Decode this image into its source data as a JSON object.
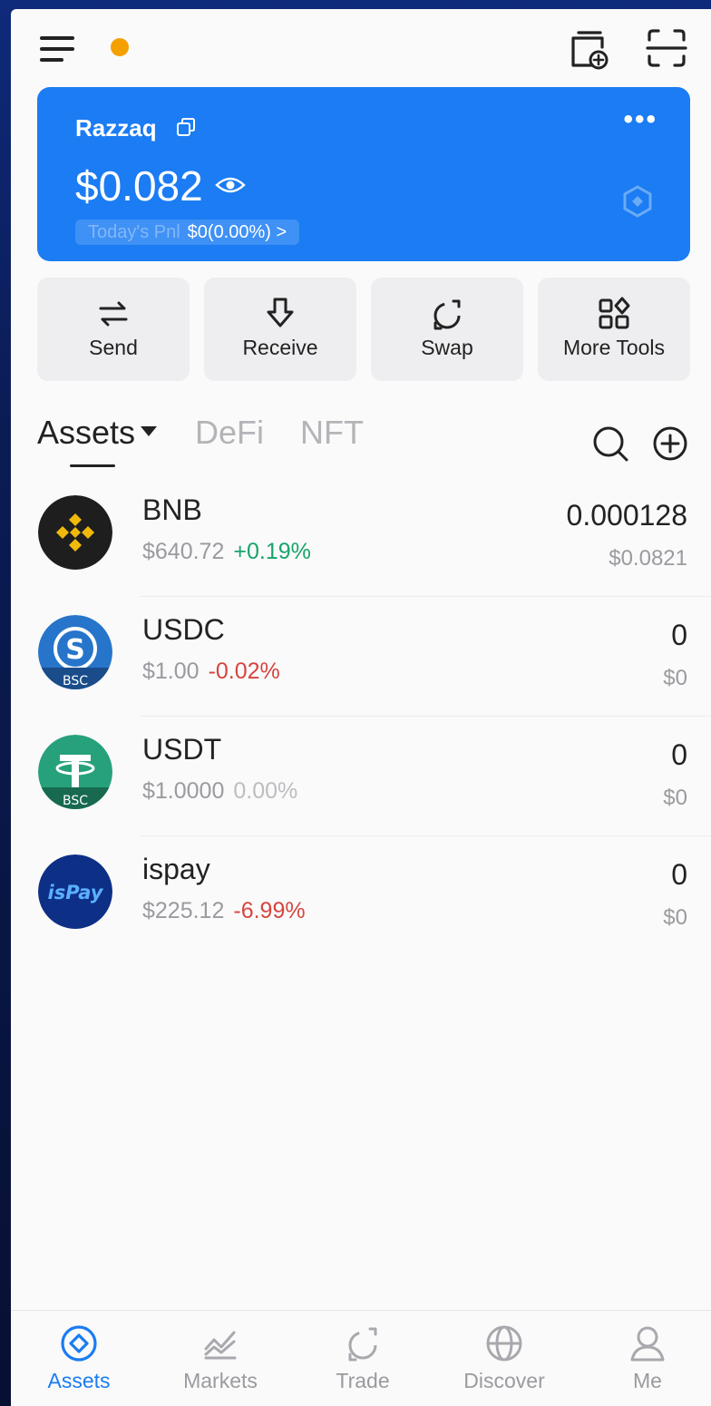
{
  "account": {
    "name": "Razzaq",
    "balance": "$0.082",
    "pnl_label": "Today's Pnl",
    "pnl_value": "$0(0.00%) >"
  },
  "actions": [
    {
      "label": "Send",
      "icon": "send-icon"
    },
    {
      "label": "Receive",
      "icon": "receive-icon"
    },
    {
      "label": "Swap",
      "icon": "swap-icon"
    },
    {
      "label": "More Tools",
      "icon": "grid-icon"
    }
  ],
  "tabs": [
    {
      "label": "Assets",
      "active": true
    },
    {
      "label": "DeFi",
      "active": false
    },
    {
      "label": "NFT",
      "active": false
    }
  ],
  "assets": [
    {
      "symbol": "BNB",
      "price": "$640.72",
      "change": "+0.19%",
      "trend": "up",
      "amount": "0.000128",
      "value": "$0.0821"
    },
    {
      "symbol": "USDC",
      "price": "$1.00",
      "change": "-0.02%",
      "trend": "down",
      "amount": "0",
      "value": "$0",
      "badge": "BSC"
    },
    {
      "symbol": "USDT",
      "price": "$1.0000",
      "change": "0.00%",
      "trend": "flat",
      "amount": "0",
      "value": "$0",
      "badge": "BSC"
    },
    {
      "symbol": "ispay",
      "price": "$225.12",
      "change": "-6.99%",
      "trend": "down",
      "amount": "0",
      "value": "$0",
      "logo_text": "isPay"
    }
  ],
  "nav": [
    {
      "label": "Assets",
      "icon": "assets-icon",
      "active": true
    },
    {
      "label": "Markets",
      "icon": "markets-icon",
      "active": false
    },
    {
      "label": "Trade",
      "icon": "trade-icon",
      "active": false
    },
    {
      "label": "Discover",
      "icon": "discover-icon",
      "active": false
    },
    {
      "label": "Me",
      "icon": "profile-icon",
      "active": false
    }
  ],
  "colors": {
    "accent": "#1b7cf3",
    "up": "#19a46b",
    "down": "#d6453f",
    "notification_dot": "#f4a100"
  }
}
